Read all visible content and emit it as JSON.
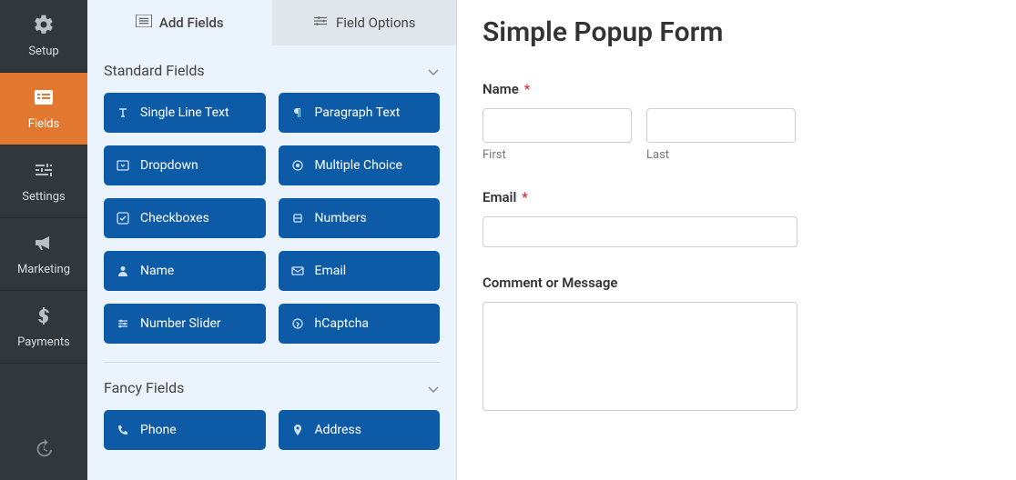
{
  "nav": {
    "items": [
      {
        "label": "Setup",
        "icon": "gear"
      },
      {
        "label": "Fields",
        "icon": "list"
      },
      {
        "label": "Settings",
        "icon": "sliders"
      },
      {
        "label": "Marketing",
        "icon": "bullhorn"
      },
      {
        "label": "Payments",
        "icon": "dollar"
      }
    ],
    "history_icon": "history"
  },
  "tabs": {
    "add": "Add Fields",
    "options": "Field Options"
  },
  "groups": {
    "standard": {
      "title": "Standard Fields"
    },
    "fancy": {
      "title": "Fancy Fields"
    }
  },
  "fields": {
    "single_line": "Single Line Text",
    "paragraph": "Paragraph Text",
    "dropdown": "Dropdown",
    "multiple": "Multiple Choice",
    "checkboxes": "Checkboxes",
    "numbers": "Numbers",
    "name": "Name",
    "email": "Email",
    "slider": "Number Slider",
    "hcaptcha": "hCaptcha",
    "phone": "Phone",
    "address": "Address"
  },
  "form": {
    "title": "Simple Popup Form",
    "name_label": "Name",
    "name_required": "*",
    "first_sub": "First",
    "last_sub": "Last",
    "email_label": "Email",
    "email_required": "*",
    "comment_label": "Comment or Message"
  }
}
